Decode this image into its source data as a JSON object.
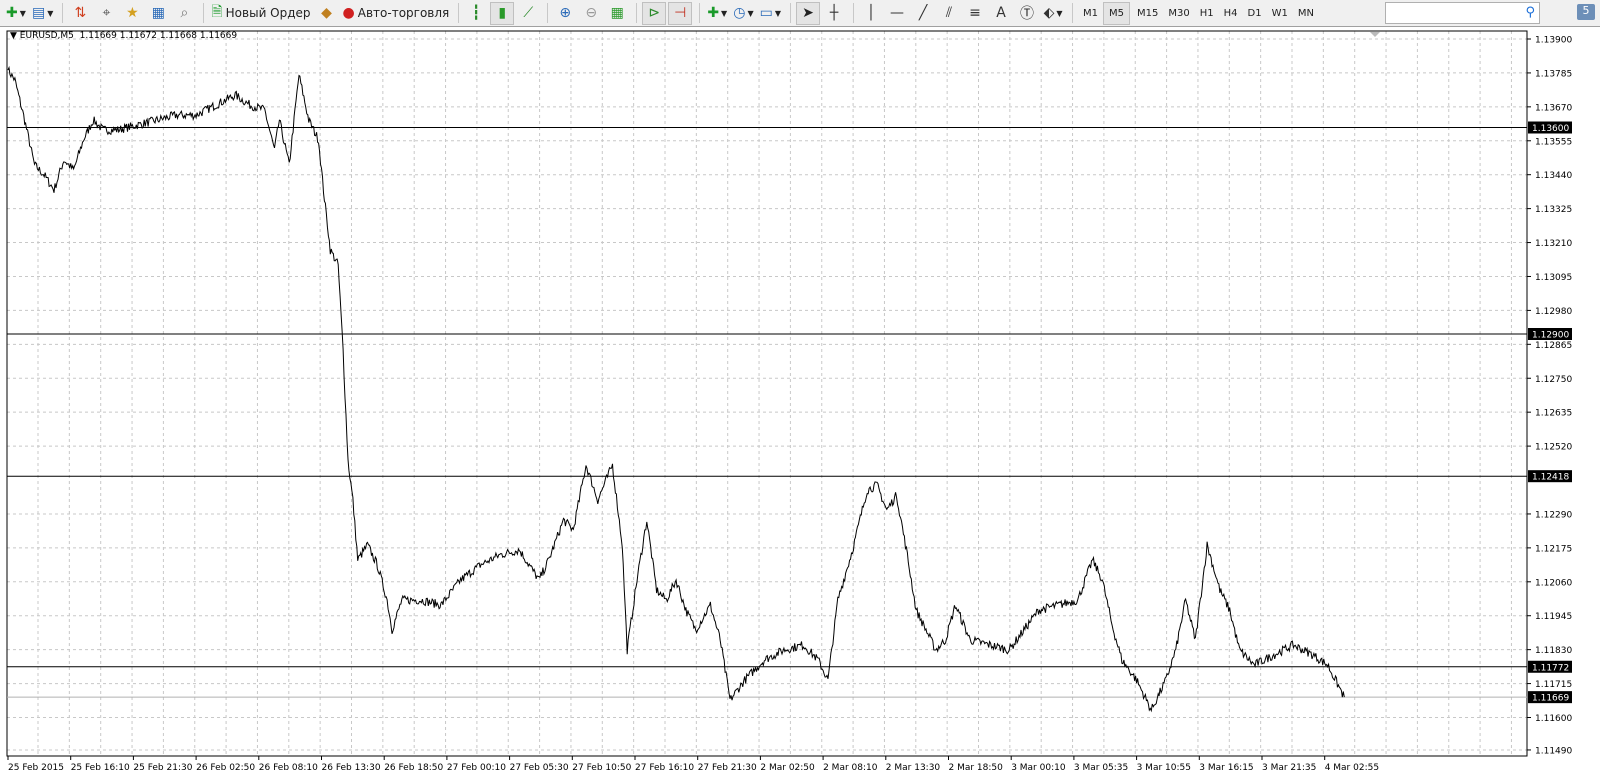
{
  "toolbar": {
    "new_order": "Новый Ордер",
    "auto_trading": "Авто-торговля",
    "timeframes": [
      "M1",
      "M5",
      "M15",
      "M30",
      "H1",
      "H4",
      "D1",
      "W1",
      "MN"
    ],
    "active_timeframe": "M5",
    "search_placeholder": "",
    "messages_count": "5"
  },
  "chart_header": {
    "symbol": "EURUSD,M5",
    "ohlc": "1.11669 1.11672 1.11668 1.11669"
  },
  "chart_data": {
    "type": "line",
    "symbol": "EURUSD",
    "timeframe": "M5",
    "ylim": [
      1.1149,
      1.139
    ],
    "y_ticks": [
      "1.13900",
      "1.13785",
      "1.13670",
      "1.13555",
      "1.13440",
      "1.13325",
      "1.13210",
      "1.13095",
      "1.12980",
      "1.12865",
      "1.12750",
      "1.12635",
      "1.12520",
      "1.12290",
      "1.12175",
      "1.12060",
      "1.11945",
      "1.11830",
      "1.11715",
      "1.11600",
      "1.11490"
    ],
    "x_ticks": [
      "25 Feb 2015",
      "25 Feb 16:10",
      "25 Feb 21:30",
      "26 Feb 02:50",
      "26 Feb 08:10",
      "26 Feb 13:30",
      "26 Feb 18:50",
      "27 Feb 00:10",
      "27 Feb 05:30",
      "27 Feb 10:50",
      "27 Feb 16:10",
      "27 Feb 21:30",
      "2 Mar 02:50",
      "2 Mar 08:10",
      "2 Mar 13:30",
      "2 Mar 18:50",
      "3 Mar 00:10",
      "3 Mar 05:35",
      "3 Mar 10:55",
      "3 Mar 16:15",
      "3 Mar 21:35",
      "4 Mar 02:55"
    ],
    "bars_per_tick": 64,
    "series": {
      "bar": [
        0,
        7,
        17,
        27,
        37,
        47,
        57,
        67,
        77,
        87,
        97,
        112,
        132,
        152,
        172,
        192,
        212,
        232,
        247,
        262,
        272,
        277,
        287,
        297,
        307,
        317,
        322,
        329,
        337,
        342,
        347,
        352,
        357,
        367,
        377,
        387,
        392,
        402,
        422,
        442,
        462,
        482,
        502,
        522,
        542,
        552,
        567,
        577,
        590,
        602,
        617,
        627,
        632,
        642,
        652,
        662,
        672,
        682,
        692,
        702,
        717,
        727,
        737,
        752,
        772,
        792,
        812,
        827,
        837,
        847,
        862,
        877,
        887,
        897,
        907,
        917,
        927,
        937,
        947,
        957,
        967,
        982,
        1002,
        1022,
        1037,
        1052,
        1072,
        1092,
        1107,
        1117,
        1127,
        1137,
        1152,
        1167,
        1182,
        1192,
        1202,
        1212,
        1224,
        1237,
        1247,
        1257,
        1272,
        1292,
        1312,
        1332,
        1347,
        1364
      ],
      "close": [
        1.13795,
        1.13761,
        1.13625,
        1.13473,
        1.13439,
        1.13388,
        1.1349,
        1.13456,
        1.13558,
        1.13625,
        1.13592,
        1.13592,
        1.13608,
        1.13625,
        1.13642,
        1.13642,
        1.13676,
        1.1371,
        1.13676,
        1.13659,
        1.13524,
        1.13625,
        1.13473,
        1.13778,
        1.13625,
        1.13558,
        1.13388,
        1.13185,
        1.13134,
        1.12846,
        1.12473,
        1.12337,
        1.12134,
        1.12185,
        1.12117,
        1.11998,
        1.11897,
        1.11998,
        1.11998,
        1.11981,
        1.12066,
        1.12117,
        1.12151,
        1.12168,
        1.12066,
        1.12134,
        1.12269,
        1.12236,
        1.12456,
        1.12337,
        1.12456,
        1.12185,
        1.11829,
        1.12066,
        1.12269,
        1.12032,
        1.11998,
        1.12066,
        1.11964,
        1.11897,
        1.11981,
        1.11863,
        1.11659,
        1.11727,
        1.11795,
        1.11829,
        1.11846,
        1.11795,
        1.11727,
        1.11998,
        1.12168,
        1.12371,
        1.12388,
        1.12303,
        1.12354,
        1.12168,
        1.11964,
        1.11897,
        1.11829,
        1.11863,
        1.11981,
        1.11863,
        1.11846,
        1.11829,
        1.11897,
        1.11964,
        1.11981,
        1.11998,
        1.12134,
        1.12066,
        1.11913,
        1.11795,
        1.11727,
        1.11625,
        1.11727,
        1.11829,
        1.11998,
        1.11863,
        1.12185,
        1.12032,
        1.11964,
        1.11829,
        1.11778,
        1.11812,
        1.11846,
        1.11812,
        1.11778,
        1.11669
      ]
    },
    "levels": [
      {
        "price": "1.13600"
      },
      {
        "price": "1.12900"
      },
      {
        "price": "1.12418"
      },
      {
        "price": "1.11772"
      }
    ],
    "bid": "1.11669"
  }
}
